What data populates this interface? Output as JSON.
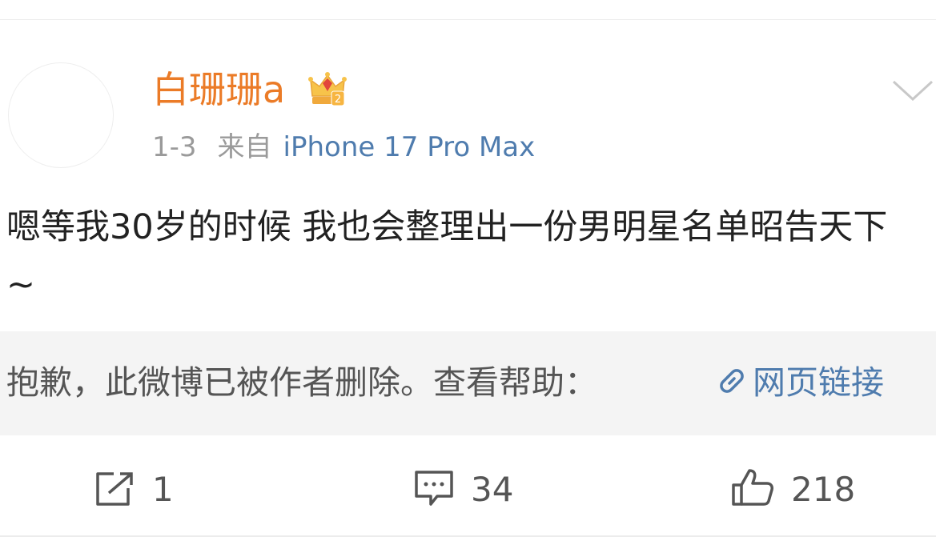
{
  "post": {
    "user": {
      "name": "白珊珊a",
      "vip_badge_icon": "vip-crown-icon",
      "vip_level": "2"
    },
    "meta": {
      "date": "1-3",
      "from_label": "来自",
      "device": "iPhone 17 Pro Max"
    },
    "text": "嗯等我30岁的时候 我也会整理出一份男明星名单昭告天下 ~",
    "deleted_notice": {
      "text": "抱歉，此微博已被作者删除。查看帮助：",
      "link_icon": "link-icon",
      "link_label": "网页链接"
    }
  },
  "actions": {
    "repost": {
      "icon": "repost-icon",
      "count": "1"
    },
    "comment": {
      "icon": "comment-icon",
      "count": "34"
    },
    "like": {
      "icon": "thumbs-up-icon",
      "count": "218"
    }
  },
  "colors": {
    "username": "#eb7b27",
    "link": "#4f7cae",
    "meta_gray": "#9a9a9a",
    "body_text": "#222222",
    "deleted_bg": "#f4f4f4"
  }
}
